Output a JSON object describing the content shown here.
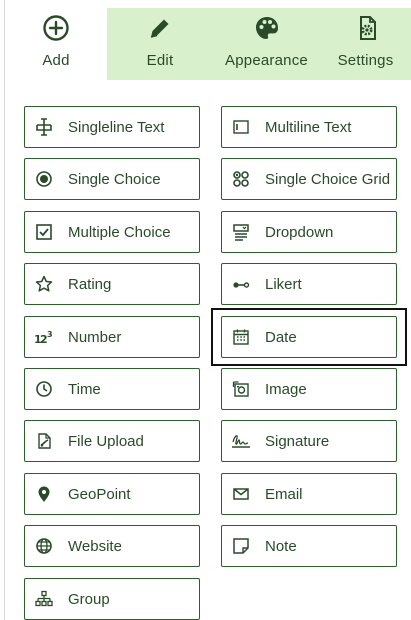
{
  "toolbar": {
    "tabs": [
      {
        "label": "Add",
        "icon": "add-circle-icon",
        "active": true
      },
      {
        "label": "Edit",
        "icon": "pencil-icon",
        "active": false
      },
      {
        "label": "Appearance",
        "icon": "palette-icon",
        "active": false
      },
      {
        "label": "Settings",
        "icon": "settings-document-icon",
        "active": false
      }
    ]
  },
  "fields": [
    {
      "label": "Singleline Text",
      "icon": "singleline-text-icon"
    },
    {
      "label": "Multiline Text",
      "icon": "multiline-text-icon"
    },
    {
      "label": "Single Choice",
      "icon": "radio-icon"
    },
    {
      "label": "Single Choice Grid",
      "icon": "grid-choice-icon"
    },
    {
      "label": "Multiple Choice",
      "icon": "checkbox-icon"
    },
    {
      "label": "Dropdown",
      "icon": "dropdown-icon"
    },
    {
      "label": "Rating",
      "icon": "star-icon"
    },
    {
      "label": "Likert",
      "icon": "likert-icon"
    },
    {
      "label": "Number",
      "icon": "number-icon"
    },
    {
      "label": "Date",
      "icon": "calendar-icon",
      "selected": true
    },
    {
      "label": "Time",
      "icon": "clock-icon"
    },
    {
      "label": "Image",
      "icon": "image-icon"
    },
    {
      "label": "File Upload",
      "icon": "file-upload-icon"
    },
    {
      "label": "Signature",
      "icon": "signature-icon"
    },
    {
      "label": "GeoPoint",
      "icon": "map-pin-icon"
    },
    {
      "label": "Email",
      "icon": "envelope-icon"
    },
    {
      "label": "Website",
      "icon": "globe-icon"
    },
    {
      "label": "Note",
      "icon": "note-icon"
    },
    {
      "label": "Group",
      "icon": "group-icon"
    }
  ],
  "colors": {
    "accent": "#2d5e2d",
    "inactive_tab": "#d8f1cc",
    "selection_frame": "#111111"
  }
}
